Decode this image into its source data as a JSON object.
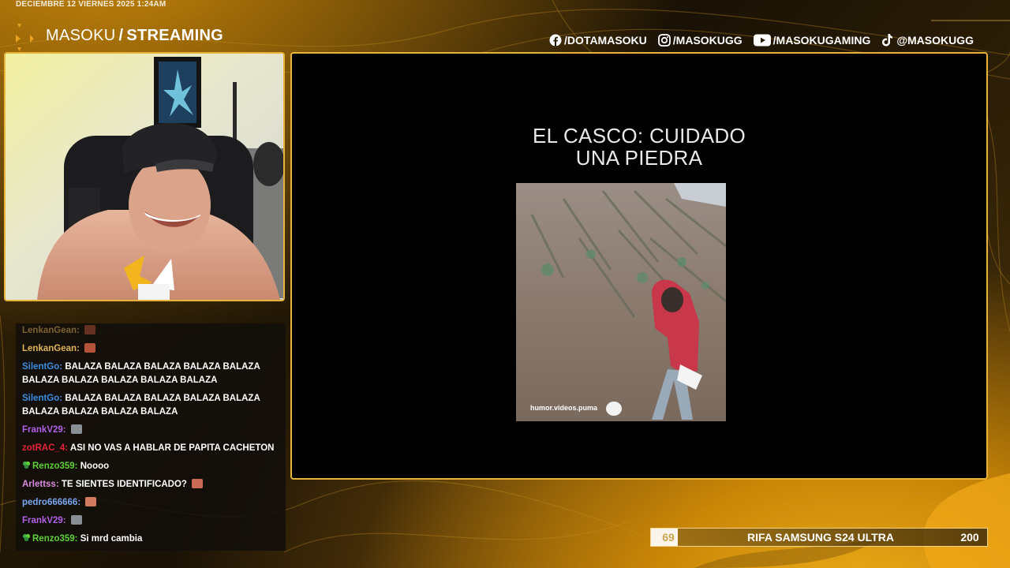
{
  "overlay": {
    "datetime": "DECIEMBRE 12 VIERNES 2025 1:24AM",
    "brand_name": "MASOKU",
    "brand_separator": "/",
    "brand_section": "STREAMING"
  },
  "socials": [
    {
      "icon": "facebook-icon",
      "handle": "/DOTAMASOKU"
    },
    {
      "icon": "instagram-icon",
      "handle": "/MASOKUGG"
    },
    {
      "icon": "youtube-icon",
      "handle": "/MASOKUGAMING"
    },
    {
      "icon": "tiktok-icon",
      "handle": "@MASOKUGG"
    }
  ],
  "video": {
    "title_line1": "EL CASCO: CUIDADO",
    "title_line2": "UNA PIEDRA",
    "watermark": "humor.videos.puma"
  },
  "chat": {
    "messages": [
      {
        "user": "LenkanGean:",
        "color": "#e0b45a",
        "text": "",
        "emote": "#b5533a"
      },
      {
        "user": "SilentGo:",
        "color": "#3b8de2",
        "text": "BALAZA BALAZA BALAZA BALAZA BALAZA BALAZA BALAZA BALAZA BALAZA BALAZA"
      },
      {
        "user": "SilentGo:",
        "color": "#3b8de2",
        "text": "BALAZA BALAZA BALAZA BALAZA BALAZA BALAZA BALAZA BALAZA BALAZA"
      },
      {
        "user": "FrankV29:",
        "color": "#b061e6",
        "text": "",
        "emote": "#8a8f95"
      },
      {
        "user": "zotRAC_4:",
        "color": "#e3243a",
        "text": "ASI NO VAS A HABLAR DE PAPITA CACHETON"
      },
      {
        "user": "Renzo359:",
        "color": "#5ed13a",
        "text": "Noooo",
        "badge": true
      },
      {
        "user": "Arlettss:",
        "color": "#d98be0",
        "text": "TE SIENTES IDENTIFICADO?",
        "emote": "#c96a56"
      },
      {
        "user": "pedro666666:",
        "color": "#7aa8f0",
        "text": "",
        "emote": "#d07a62"
      },
      {
        "user": "FrankV29:",
        "color": "#b061e6",
        "text": "",
        "emote": "#8a8f95"
      },
      {
        "user": "Renzo359:",
        "color": "#5ed13a",
        "text": "Si mrd cambia",
        "badge": true
      }
    ]
  },
  "raffle": {
    "current": "69",
    "label": "RIFA SAMSUNG S24 ULTRA",
    "goal": "200",
    "progress_fraction": 0.0
  },
  "colors": {
    "accent_gold": "#e8b33a",
    "chat_bg": "#120e0a"
  }
}
